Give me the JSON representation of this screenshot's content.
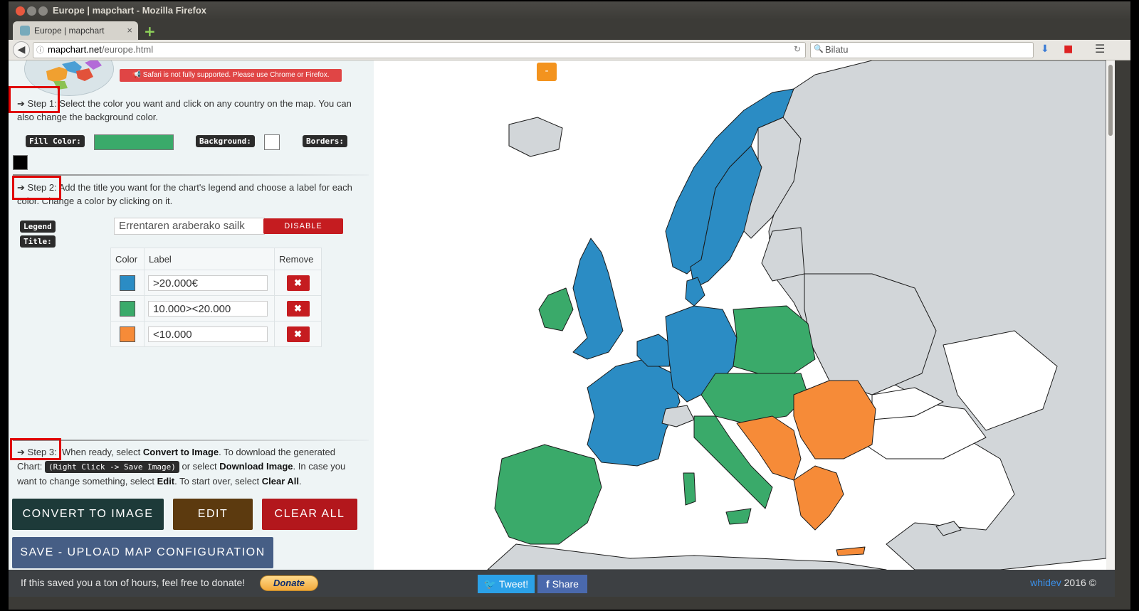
{
  "window": {
    "title": "Europe | mapchart - Mozilla Firefox"
  },
  "tab": {
    "label": "Europe | mapchart",
    "close": "×",
    "new_tab": "+"
  },
  "nav": {
    "url_host": "mapchart.net",
    "url_path": "/europe.html",
    "search_placeholder": "Bilatu"
  },
  "warning": "Safari is not fully supported. Please use Chrome or Firefox.",
  "step1": {
    "label": "Step 1:",
    "text_a": "Select the color you want and click on any country on the map. You can",
    "text_b": "also change the background color.",
    "fill_label": "Fill Color:",
    "background_label": "Background:",
    "borders_label": "Borders:",
    "fill_color": "#3aaa6a",
    "background_color": "#ffffff",
    "border_color": "#000000"
  },
  "step2": {
    "label": "Step 2:",
    "text_a": "Add the title you want for the chart's legend and choose a label for each",
    "text_b": "color. Change a color by clicking on it.",
    "legend_title_label_a": "Legend",
    "legend_title_label_b": "Title:",
    "legend_title_value": "Errentaren araberako sailk",
    "disable_label": "DISABLE",
    "table": {
      "headers": [
        "Color",
        "Label",
        "Remove"
      ],
      "rows": [
        {
          "color": "#2b8cc4",
          "label": ">20.000€"
        },
        {
          "color": "#3aaa6a",
          "label": "10.000><20.000"
        },
        {
          "color": "#f68b38",
          "label": "<10.000"
        }
      ],
      "remove_icon": "✖"
    }
  },
  "step3": {
    "label": "Step 3:",
    "t1": "When ready, select",
    "b1": "Convert to Image",
    "t2": ". To download the generated",
    "t3": "Chart:",
    "kbd": "(Right Click -> Save Image)",
    "t4": "or select",
    "b2": "Download Image",
    "t5": ". In case you",
    "t6": "want to change something, select",
    "b3": "Edit",
    "t7": ". To start over, select",
    "b4": "Clear All",
    "t8": "."
  },
  "buttons": {
    "convert": "CONVERT TO IMAGE",
    "edit": "EDIT",
    "clear": "CLEAR ALL",
    "save": "SAVE - UPLOAD MAP CONFIGURATION"
  },
  "map": {
    "minus_label": "-"
  },
  "footer": {
    "message": "If this saved you a ton of hours, feel free to donate!",
    "donate": "Donate",
    "tweet": "Tweet!",
    "share": "Share",
    "brand": "whidev",
    "year": "2016 ©"
  },
  "colors": {
    "blue": "#2b8cc4",
    "green": "#3aaa6a",
    "orange": "#f68b38",
    "gray": "#d2d6d9",
    "white": "#ffffff",
    "footer_bg": "#3d4043"
  }
}
